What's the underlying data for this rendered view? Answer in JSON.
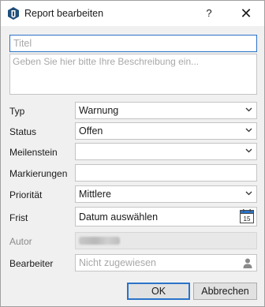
{
  "window": {
    "title": "Report bearbeiten",
    "help_label": "?",
    "close_label": "✕"
  },
  "form": {
    "title_placeholder": "Titel",
    "description_placeholder": "Geben Sie hier bitte Ihre Beschreibung ein...",
    "type": {
      "label": "Typ",
      "value": "Warnung"
    },
    "status": {
      "label": "Status",
      "value": "Offen"
    },
    "milestone": {
      "label": "Meilenstein",
      "value": ""
    },
    "tags": {
      "label": "Markierungen",
      "value": ""
    },
    "priority": {
      "label": "Priorität",
      "value": "Mittlere"
    },
    "deadline": {
      "label": "Frist",
      "value": "Datum auswählen",
      "calendar_day": "15"
    },
    "author": {
      "label": "Autor"
    },
    "assignee": {
      "label": "Bearbeiter",
      "placeholder": "Nicht zugewiesen"
    }
  },
  "buttons": {
    "ok": "OK",
    "cancel": "Abbrechen"
  },
  "colors": {
    "accent": "#2a73c9",
    "background": "#f0f0f0"
  }
}
